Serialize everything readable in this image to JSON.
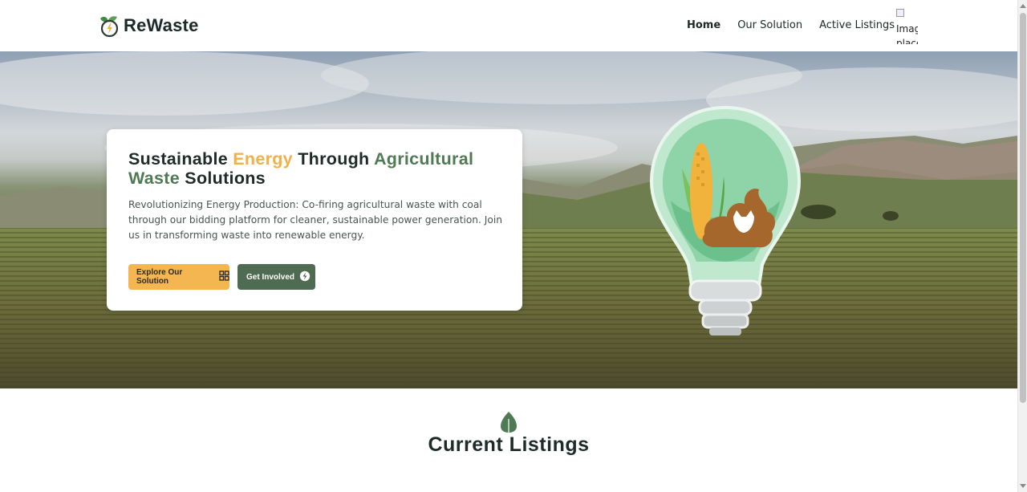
{
  "brand": {
    "name": "ReWaste"
  },
  "nav": {
    "items": [
      {
        "label": "Home",
        "active": true
      },
      {
        "label": "Our Solution",
        "active": false
      },
      {
        "label": "Active Listings",
        "active": false
      }
    ],
    "profile_image_alt": "Image placeholder"
  },
  "hero": {
    "title_part1": "Sustainable ",
    "title_highlight_energy": "Energy",
    "title_part2": " Through ",
    "title_highlight_waste": "Agricultural Waste",
    "title_part3": " Solutions",
    "description": "Revolutionizing Energy Production: Co-firing agricultural waste with coal through our bidding platform for cleaner, sustainable power generation. Join us in transforming waste into renewable energy.",
    "buttons": {
      "explore_label": "Explore Our Solution",
      "involved_label": "Get Involved"
    }
  },
  "listings": {
    "title": "Current Listings"
  },
  "colors": {
    "accent_orange": "#f0b04a",
    "accent_green": "#4e7a54",
    "button_green": "#4f6b52",
    "button_orange": "#f3b650"
  }
}
